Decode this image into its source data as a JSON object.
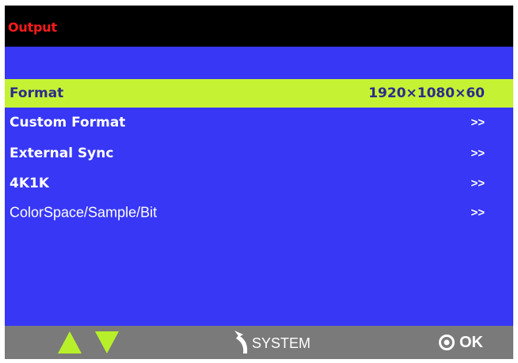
{
  "title": "Output",
  "menu": {
    "items": [
      {
        "label": "Format",
        "value": "1920×1080×60",
        "selected": true
      },
      {
        "label": "Custom Format",
        "value": ">>"
      },
      {
        "label": "External Sync",
        "value": ">>"
      },
      {
        "label": "4K1K",
        "value": ">>"
      },
      {
        "label": "ColorSpace/Sample/Bit",
        "value": ">>"
      }
    ]
  },
  "bottom_bar": {
    "up_icon": "triangle-up-icon",
    "down_icon": "triangle-down-icon",
    "back_icon": "curved-back-arrow-icon",
    "back_label": "SYSTEM",
    "ok_icon": "ring-dot-icon",
    "ok_label": "OK"
  },
  "colors": {
    "screen_bg": "#3737f5",
    "title_bg": "#000000",
    "title_text": "#ff1a1a",
    "selected_bg": "#c6f234",
    "selected_text": "#2c2c8a",
    "bottom_bar_bg": "#7a7a7a",
    "nav_arrow": "#b7f02a"
  }
}
